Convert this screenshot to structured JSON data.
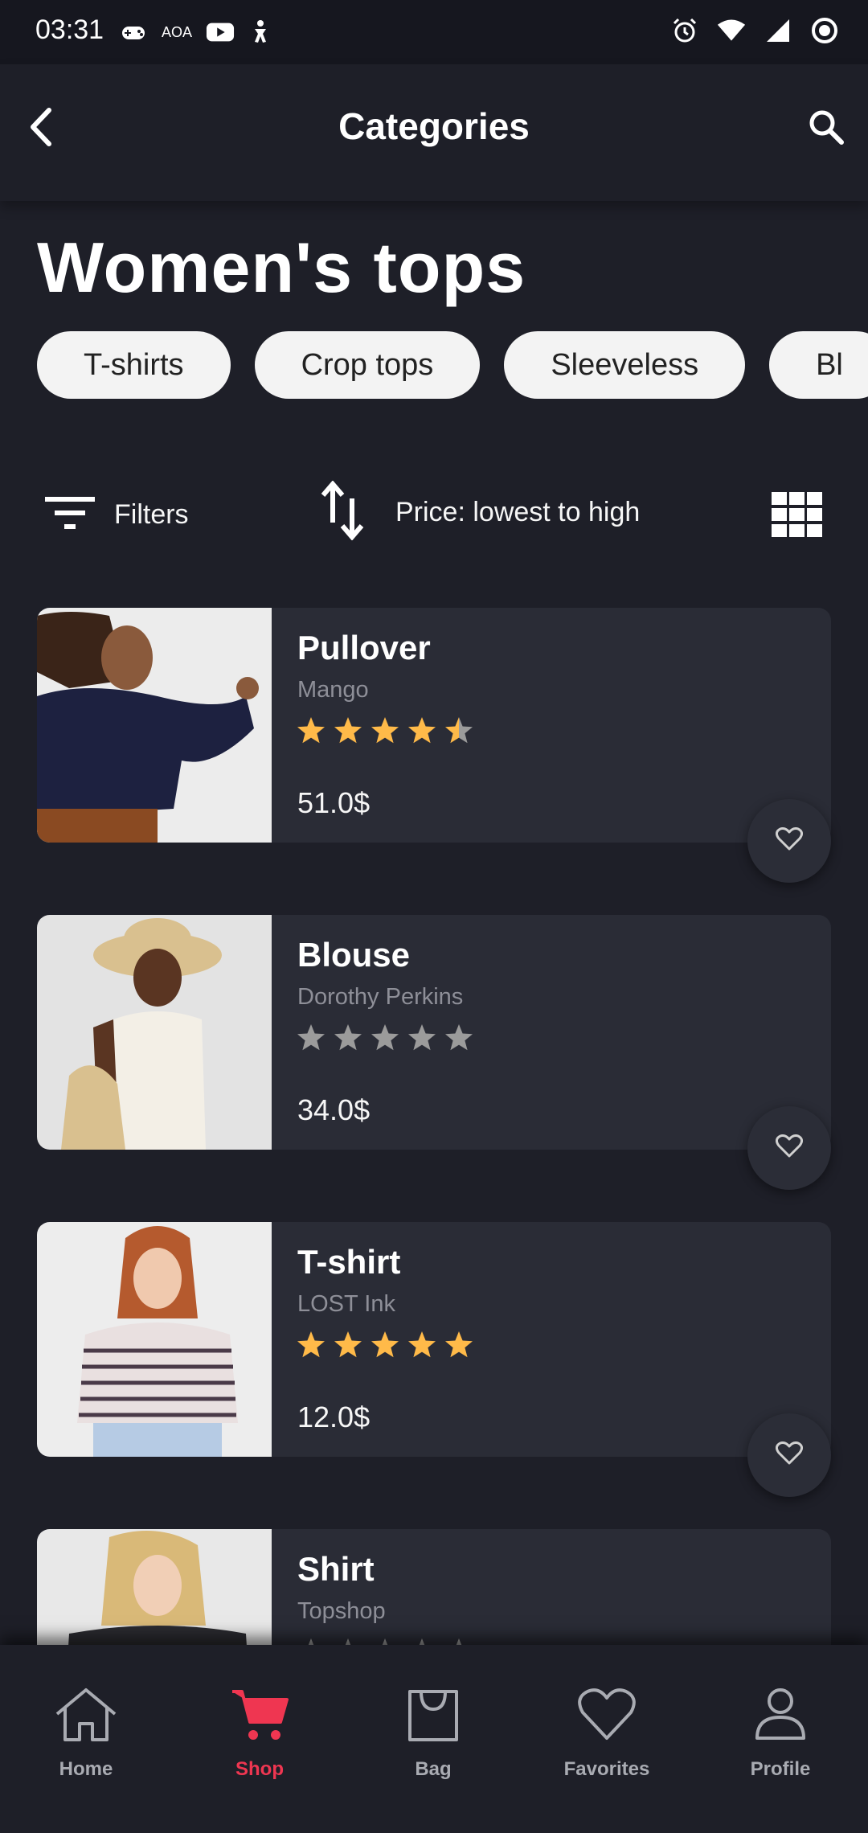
{
  "status_bar": {
    "time": "03:31",
    "left_icons": [
      "game-controller-icon",
      "aoa-text-icon",
      "youtube-icon",
      "accessibility-icon"
    ],
    "aoa_text": "AOA",
    "right_icons": [
      "alarm-icon",
      "wifi-icon",
      "signal-icon",
      "record-icon"
    ]
  },
  "app_bar": {
    "title": "Categories",
    "back_icon": "chevron-left-icon",
    "search_icon": "search-icon"
  },
  "page_title": "Women's tops",
  "chips": [
    "T-shirts",
    "Crop tops",
    "Sleeveless",
    "Bl"
  ],
  "toolbar": {
    "filters_label": "Filters",
    "sort_label": "Price: lowest to high",
    "view_icon": "grid-view-icon"
  },
  "products": [
    {
      "name": "Pullover",
      "brand": "Mango",
      "rating": 4.5,
      "price": "51.0$"
    },
    {
      "name": "Blouse",
      "brand": "Dorothy Perkins",
      "rating": 0,
      "price": "34.0$"
    },
    {
      "name": "T-shirt",
      "brand": "LOST Ink",
      "rating": 5,
      "price": "12.0$"
    },
    {
      "name": "Shirt",
      "brand": "Topshop",
      "rating": 0,
      "price": ""
    }
  ],
  "bottom_nav": {
    "items": [
      {
        "label": "Home",
        "icon": "home-icon",
        "active": false
      },
      {
        "label": "Shop",
        "icon": "cart-icon",
        "active": true
      },
      {
        "label": "Bag",
        "icon": "bag-icon",
        "active": false
      },
      {
        "label": "Favorites",
        "icon": "heart-icon",
        "active": false
      },
      {
        "label": "Profile",
        "icon": "profile-icon",
        "active": false
      }
    ]
  },
  "colors": {
    "background": "#1e1f28",
    "card": "#2a2c36",
    "accent": "#ef3651",
    "star": "#ffba49",
    "star_empty": "#9b9b9b",
    "muted_text": "#8e8f98"
  }
}
